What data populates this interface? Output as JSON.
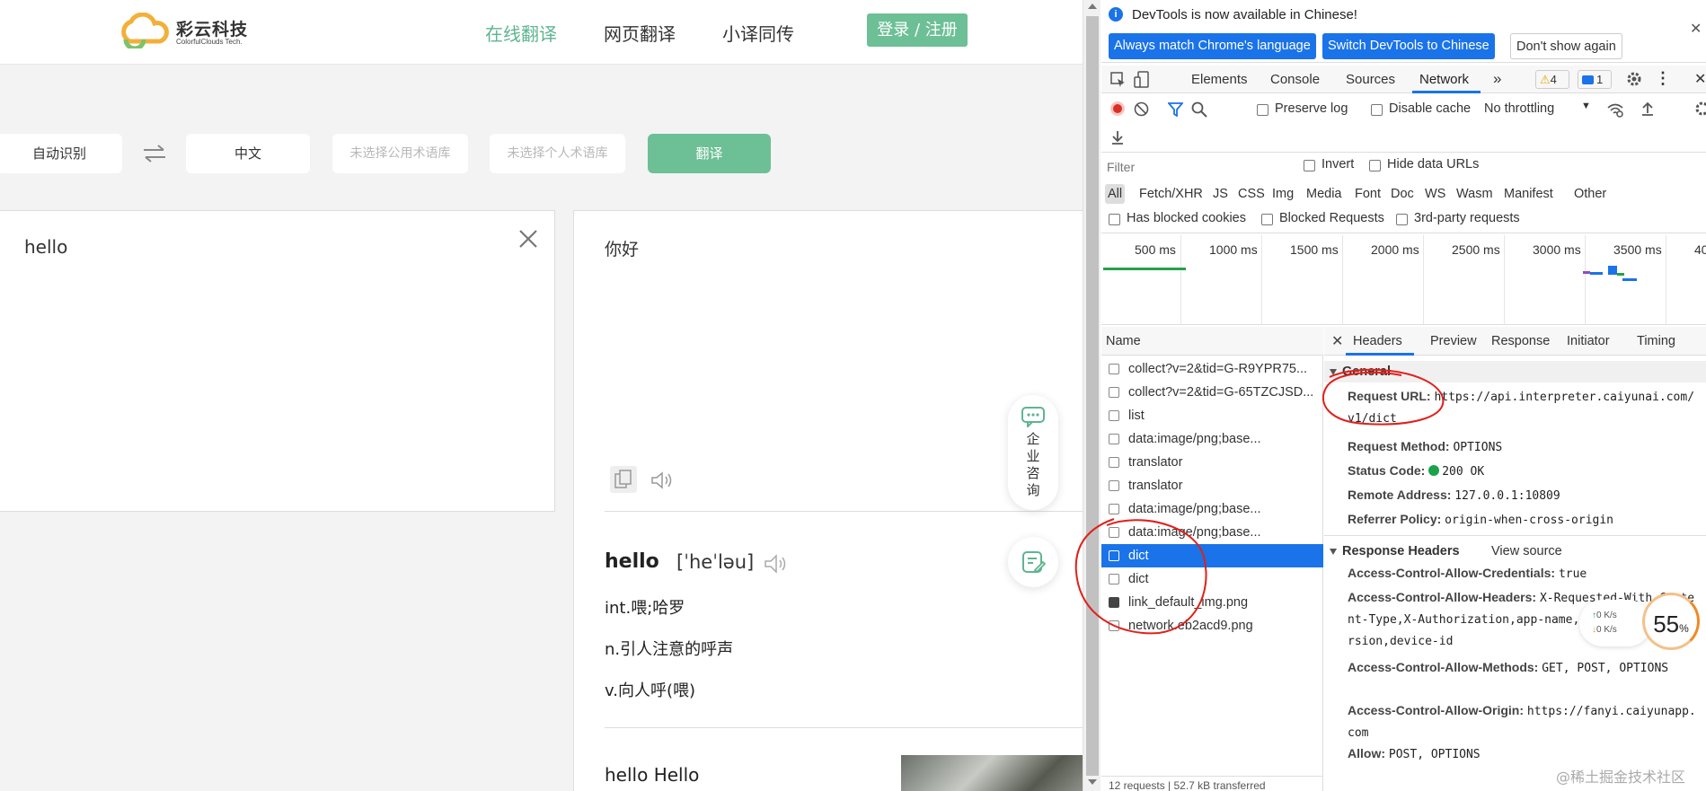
{
  "site": {
    "logo_cn": "彩云科技",
    "logo_en": "ColorfulClouds Tech.",
    "nav": [
      "在线翻译",
      "网页翻译",
      "小译同传"
    ],
    "login": "登录 / 注册"
  },
  "translator": {
    "source_lang": "自动识别",
    "target_lang": "中文",
    "public_glossary": "未选择公用术语库",
    "private_glossary": "未选择个人术语库",
    "translate_button": "翻译",
    "source_text": "hello",
    "result_text": "你好",
    "dict_word": "hello",
    "dict_phonetic": "[ˈheˈləu]",
    "definitions": [
      "int.喂;哈罗",
      "n.引人注意的呼声",
      "v.向人呼(喂)"
    ],
    "example_title": "hello Hello",
    "consult_label": "企业咨询"
  },
  "devtools": {
    "info_text": "DevTools is now available in Chinese!",
    "info_buttons": [
      "Always match Chrome's language",
      "Switch DevTools to Chinese",
      "Don't show again"
    ],
    "tabs": [
      "Elements",
      "Console",
      "Sources",
      "Network"
    ],
    "active_tab": "Network",
    "warnings": "4",
    "messages": "1",
    "toolbar": {
      "preserve_log": "Preserve log",
      "disable_cache": "Disable cache",
      "throttling": "No throttling"
    },
    "filter": {
      "placeholder": "Filter",
      "invert": "Invert",
      "hide_data_urls": "Hide data URLs",
      "types": [
        "All",
        "Fetch/XHR",
        "JS",
        "CSS",
        "Img",
        "Media",
        "Font",
        "Doc",
        "WS",
        "Wasm",
        "Manifest",
        "Other"
      ],
      "has_blocked_cookies": "Has blocked cookies",
      "blocked_requests": "Blocked Requests",
      "third_party": "3rd-party requests"
    },
    "timeline_ticks": [
      "500 ms",
      "1000 ms",
      "1500 ms",
      "2000 ms",
      "2500 ms",
      "3000 ms",
      "3500 ms",
      "40"
    ],
    "requests_header": "Name",
    "requests": [
      "collect?v=2&tid=G-R9YPR75...",
      "collect?v=2&tid=G-65TZCJSD...",
      "list",
      "data:image/png;base...",
      "translator",
      "translator",
      "data:image/png;base...",
      "data:image/png;base...",
      "dict",
      "dict",
      "link_default_img.png",
      "network.eb2acd9.png"
    ],
    "selected_request_index": 8,
    "footer": "12 requests | 52.7 kB transferred",
    "detail_tabs": [
      "Headers",
      "Preview",
      "Response",
      "Initiator",
      "Timing"
    ],
    "general_title": "General",
    "general": {
      "request_url_label": "Request URL:",
      "request_url": "https://api.interpreter.caiyunai.com/v1/dict",
      "request_method_label": "Request Method:",
      "request_method": "OPTIONS",
      "status_code_label": "Status Code:",
      "status_code": "200 OK",
      "remote_address_label": "Remote Address:",
      "remote_address": "127.0.0.1:10809",
      "referrer_policy_label": "Referrer Policy:",
      "referrer_policy": "origin-when-cross-origin"
    },
    "response_headers_title": "Response Headers",
    "view_source": "View source",
    "response_headers": [
      {
        "k": "Access-Control-Allow-Credentials:",
        "v": "true"
      },
      {
        "k": "Access-Control-Allow-Headers:",
        "v": "X-Requested-With,Content-Type,X-Authorization,app-name,device-type,os-version,device-id"
      },
      {
        "k": "Access-Control-Allow-Methods:",
        "v": "GET, POST, OPTIONS"
      },
      {
        "k": "Access-Control-Allow-Origin:",
        "v": "https://fanyi.caiyunapp.com"
      },
      {
        "k": "Allow:",
        "v": "POST, OPTIONS"
      }
    ]
  },
  "speed_widget": {
    "up": "0  K/s",
    "down": "0  K/s",
    "percent": "55",
    "percent_sign": "%"
  },
  "watermark": "@稀土掘金技术社区",
  "colors": {
    "brand_green": "#6dbf96",
    "devtools_blue": "#1a73e8",
    "annotation_red": "#e0201a"
  }
}
